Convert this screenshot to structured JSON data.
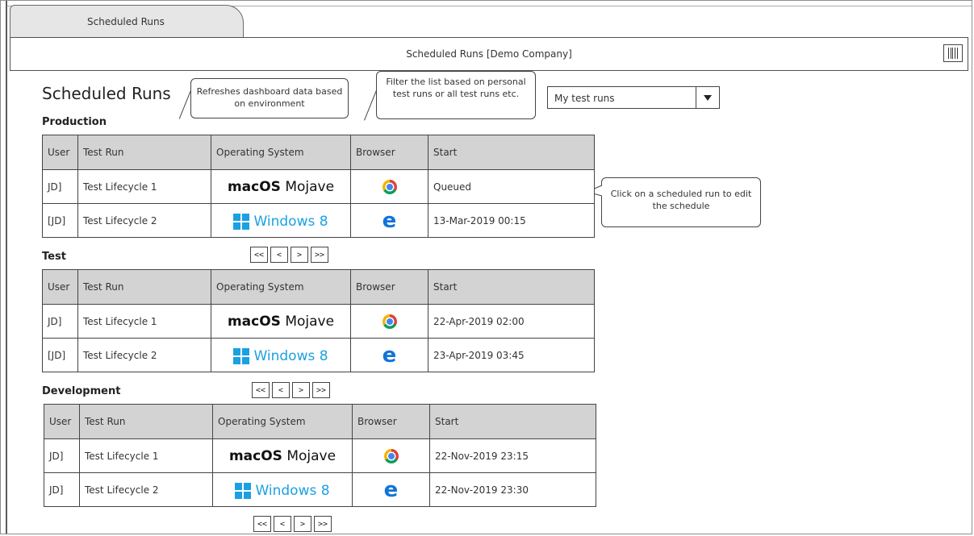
{
  "tab": {
    "label": "Scheduled Runs"
  },
  "titlebar": {
    "title": "Scheduled Runs [Demo Company]"
  },
  "page": {
    "title": "Scheduled Runs"
  },
  "callouts": {
    "environment": "Refreshes dashboard data based on environment",
    "filter": "Filter the list based on personal test runs or all test runs etc.",
    "edit": "Click on a scheduled run to edit the schedule"
  },
  "filter": {
    "selected": "My test runs"
  },
  "columns": [
    "User",
    "Test Run",
    "Operating System",
    "Browser",
    "Start"
  ],
  "os": {
    "mac_brand": "macOS",
    "mac_name": "Mojave",
    "windows": "Windows 8"
  },
  "pager": {
    "first": "<<",
    "prev": "<",
    "next": ">",
    "last": ">>"
  },
  "sections": [
    {
      "label": "Production",
      "rows": [
        {
          "user": "JD]",
          "run": "Test Lifecycle 1",
          "os": "macOS Mojave",
          "browser": "chrome-icon",
          "start": "Queued"
        },
        {
          "user": "[JD]",
          "run": "Test Lifecycle 2",
          "os": "Windows 8",
          "browser": "edge-icon",
          "start": "13-Mar-2019 00:15"
        }
      ]
    },
    {
      "label": "Test",
      "rows": [
        {
          "user": "JD]",
          "run": "Test Lifecycle 1",
          "os": "macOS Mojave",
          "browser": "chrome-icon",
          "start": "22-Apr-2019 02:00"
        },
        {
          "user": "[JD]",
          "run": "Test Lifecycle 2",
          "os": "Windows 8",
          "browser": "edge-icon",
          "start": "23-Apr-2019 03:45"
        }
      ]
    },
    {
      "label": "Development",
      "rows": [
        {
          "user": "JD]",
          "run": "Test Lifecycle 1",
          "os": "macOS Mojave",
          "browser": "chrome-icon",
          "start": "22-Nov-2019 23:15"
        },
        {
          "user": "JD]",
          "run": "Test Lifecycle 2",
          "os": "Windows 8",
          "browser": "edge-icon",
          "start": "22-Nov-2019 23:30"
        }
      ]
    }
  ],
  "icons": {
    "menu": "menu-icon",
    "dropdown": "chevron-down-icon"
  }
}
